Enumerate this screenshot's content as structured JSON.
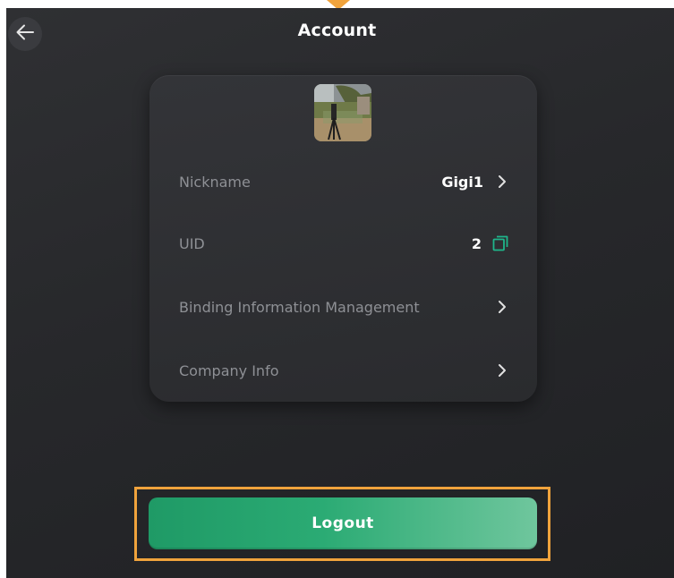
{
  "header": {
    "title": "Account",
    "back_icon": "arrow-left-icon"
  },
  "profile": {
    "avatar": "avatar-photo",
    "rows": [
      {
        "label": "Nickname",
        "value": "Gigi1",
        "icon": "chevron-right-icon"
      },
      {
        "label": "UID",
        "value": "2",
        "icon": "copy-icon"
      },
      {
        "label": "Binding Information Management",
        "value": "",
        "icon": "chevron-right-icon"
      },
      {
        "label": "Company Info",
        "value": "",
        "icon": "chevron-right-icon"
      }
    ]
  },
  "footer": {
    "logout_label": "Logout"
  },
  "colors": {
    "accent_green": "#2bab74",
    "copy_icon": "#1fb58a",
    "highlight": "#f0a33c"
  }
}
